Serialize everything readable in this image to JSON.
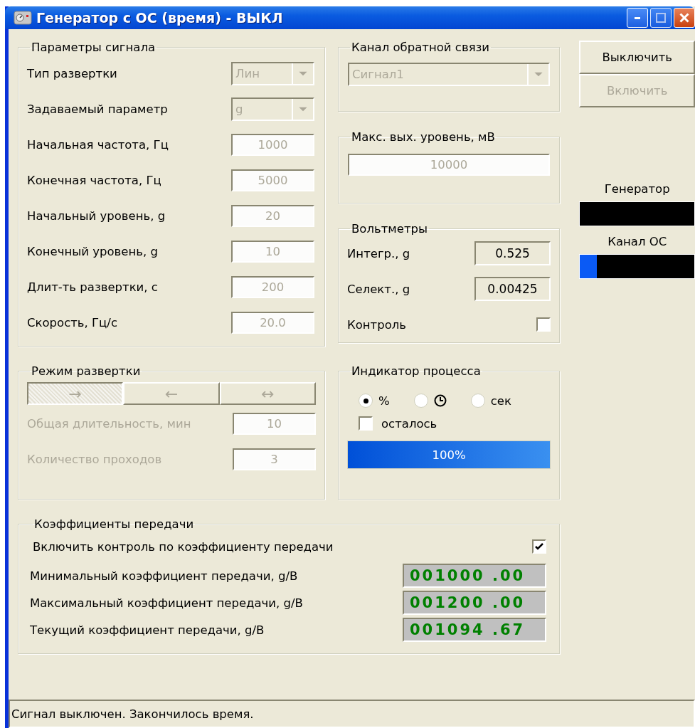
{
  "window": {
    "title": "Генератор с ОС (время) - ВЫКЛ"
  },
  "signal_params": {
    "title": "Параметры сигнала",
    "rows": [
      {
        "kind": "dropdown",
        "label": "Тип развертки",
        "value": "Лин",
        "disabled": true
      },
      {
        "kind": "dropdown",
        "label": "Задаваемый параметр",
        "value": "g",
        "disabled": true
      },
      {
        "kind": "field",
        "label": "Начальная частота, Гц",
        "value": "1000",
        "disabled": true
      },
      {
        "kind": "field",
        "label": "Конечная частота, Гц",
        "value": "5000",
        "disabled": true
      },
      {
        "kind": "field",
        "label": "Начальный уровень, g",
        "value": "20",
        "disabled": true
      },
      {
        "kind": "field",
        "label": "Конечный уровень, g",
        "value": "10",
        "disabled": true
      },
      {
        "kind": "field",
        "label": "Длит-ть развертки, с",
        "value": "200",
        "disabled": true
      },
      {
        "kind": "field",
        "label": "Скорость, Гц/с",
        "value": "20.0",
        "disabled": true
      }
    ]
  },
  "feedback_channel": {
    "title": "Канал обратной связи",
    "value": "Сигнал1",
    "disabled": true
  },
  "max_output": {
    "title": "Макс. вых. уровень, мВ",
    "value": "10000",
    "disabled": true
  },
  "voltmeters": {
    "title": "Вольтметры",
    "rows": [
      {
        "label": "Интегр., g",
        "value": "0.525"
      },
      {
        "label": "Селект., g",
        "value": "0.00425"
      }
    ],
    "control": {
      "label": "Контроль",
      "checked": false
    }
  },
  "buttons": [
    {
      "label": "Выключить",
      "disabled": false
    },
    {
      "label": "Включить",
      "disabled": true
    }
  ],
  "meters": [
    {
      "label": "Генератор",
      "level": 0
    },
    {
      "label": "Канал ОС",
      "level": 0.15
    }
  ],
  "sweep_mode": {
    "title": "Режим развертки",
    "modes": [
      {
        "label": "→",
        "selected": true
      },
      {
        "label": "←",
        "selected": false
      },
      {
        "label": "↔",
        "selected": false
      }
    ],
    "rows": [
      {
        "label": "Общая длительность, мин",
        "value": "10",
        "disabled": true
      },
      {
        "label": "Количество проходов",
        "value": "3",
        "disabled": true
      }
    ]
  },
  "progress": {
    "title": "Индикатор процесса",
    "options": [
      {
        "kind": "text",
        "label": "%",
        "selected": true
      },
      {
        "kind": "clock",
        "selected": false
      },
      {
        "kind": "text",
        "label": "сек",
        "selected": false
      }
    ],
    "remaining": {
      "label": "осталось",
      "checked": false
    },
    "level": 1,
    "reading": "100%"
  },
  "transfer": {
    "title": "Коэффициенты передачи",
    "enable": {
      "label": "Включить контроль по коэффициенту передачи",
      "checked": true
    },
    "rows": [
      {
        "label": "Минимальный коэффициент передачи, g/B",
        "value": "001000 .00"
      },
      {
        "label": "Максимальный коэффициент передачи, g/B",
        "value": "001200 .00"
      },
      {
        "label": "Текущий коэффициент передачи, g/B",
        "value": "001094 .67"
      }
    ]
  },
  "status_bar": {
    "text": "Сигнал выключен. Закончилось время."
  }
}
